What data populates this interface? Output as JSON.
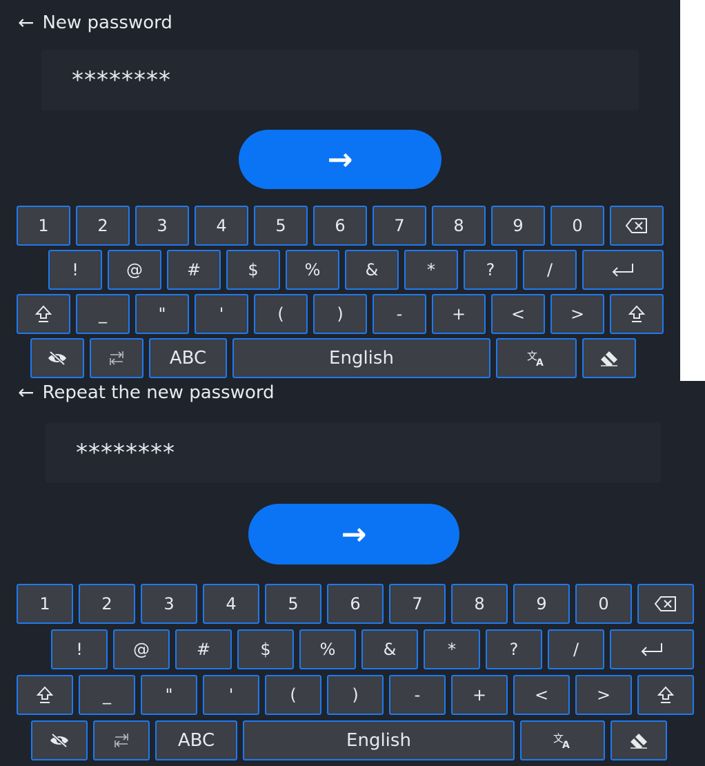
{
  "screens": [
    {
      "title": "New password",
      "password_value": "********",
      "submit_icon": "arrow-right-icon",
      "keyboard": {
        "row1": [
          "1",
          "2",
          "3",
          "4",
          "5",
          "6",
          "7",
          "8",
          "9",
          "0"
        ],
        "row2": [
          "!",
          "@",
          "#",
          "$",
          "%",
          "&",
          "*",
          "?",
          "/"
        ],
        "row3": [
          "_",
          "\"",
          "'",
          "(",
          ")",
          "-",
          "+",
          "<",
          ">"
        ],
        "abc_label": "ABC",
        "language_label": "English"
      }
    },
    {
      "title": "Repeat the new password",
      "password_value": "********",
      "submit_icon": "arrow-right-icon",
      "keyboard": {
        "row1": [
          "1",
          "2",
          "3",
          "4",
          "5",
          "6",
          "7",
          "8",
          "9",
          "0"
        ],
        "row2": [
          "!",
          "@",
          "#",
          "$",
          "%",
          "&",
          "*",
          "?",
          "/"
        ],
        "row3": [
          "_",
          "\"",
          "'",
          "(",
          ")",
          "-",
          "+",
          "<",
          ">"
        ],
        "abc_label": "ABC",
        "language_label": "English"
      }
    }
  ],
  "colors": {
    "background": "#1f232b",
    "accent": "#0a74f5",
    "key_fill": "#3c3f45",
    "key_border": "#1e7af0"
  },
  "icons": {
    "back": "back-arrow-icon",
    "backspace": "backspace-icon",
    "enter": "enter-icon",
    "shift": "shift-icon",
    "hide_password": "eye-slash-icon",
    "switch_layout": "switch-layout-icon",
    "translate": "translate-icon",
    "eraser": "eraser-icon"
  }
}
